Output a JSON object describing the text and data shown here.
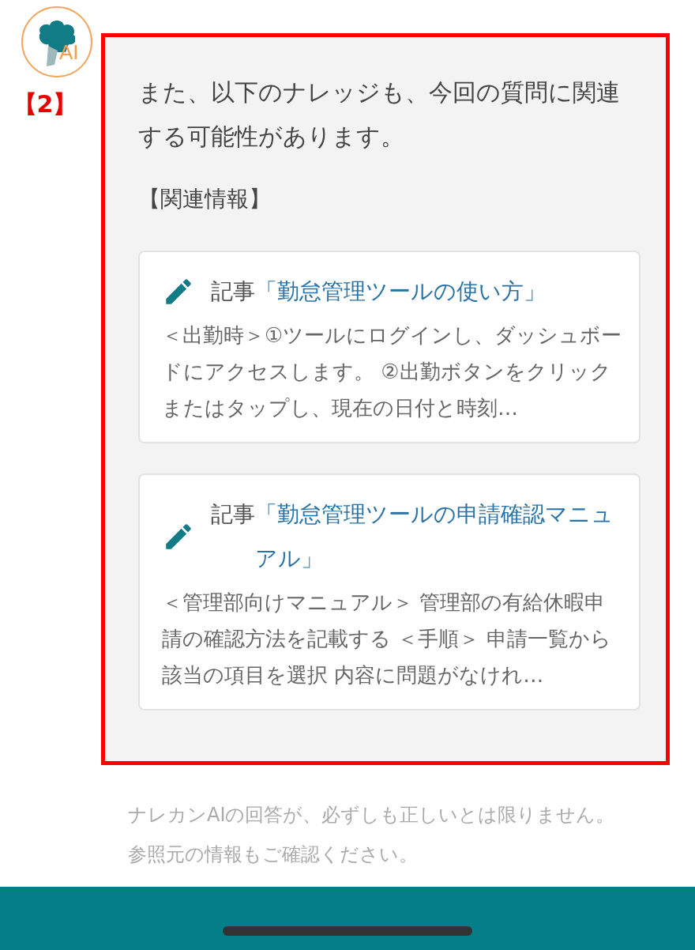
{
  "assistant": {
    "logo_text": "AI",
    "badge": "【2】"
  },
  "message": {
    "intro": "また、以下のナレッジも、今回の質問に関連する可能性があります。",
    "section_heading": "【関連情報】",
    "articles": [
      {
        "kind_label": "記事",
        "title": "「勤怠管理ツールの使い方」",
        "snippet": "＜出勤時＞①ツールにログインし、ダッシュボードにアクセスします。 ②出勤ボタンをクリックまたはタップし、現在の日付と時刻…"
      },
      {
        "kind_label": "記事",
        "title": "「勤怠管理ツールの申請確認マニュアル」",
        "snippet": "＜管理部向けマニュアル＞ 管理部の有給休暇申請の確認方法を記載する ＜手順＞ 申請一覧から該当の項目を選択 内容に問題がなけれ…"
      }
    ]
  },
  "disclaimer": "ナレカンAIの回答が、必ずしも正しいとは限りません。参照元の情報もご確認ください。"
}
